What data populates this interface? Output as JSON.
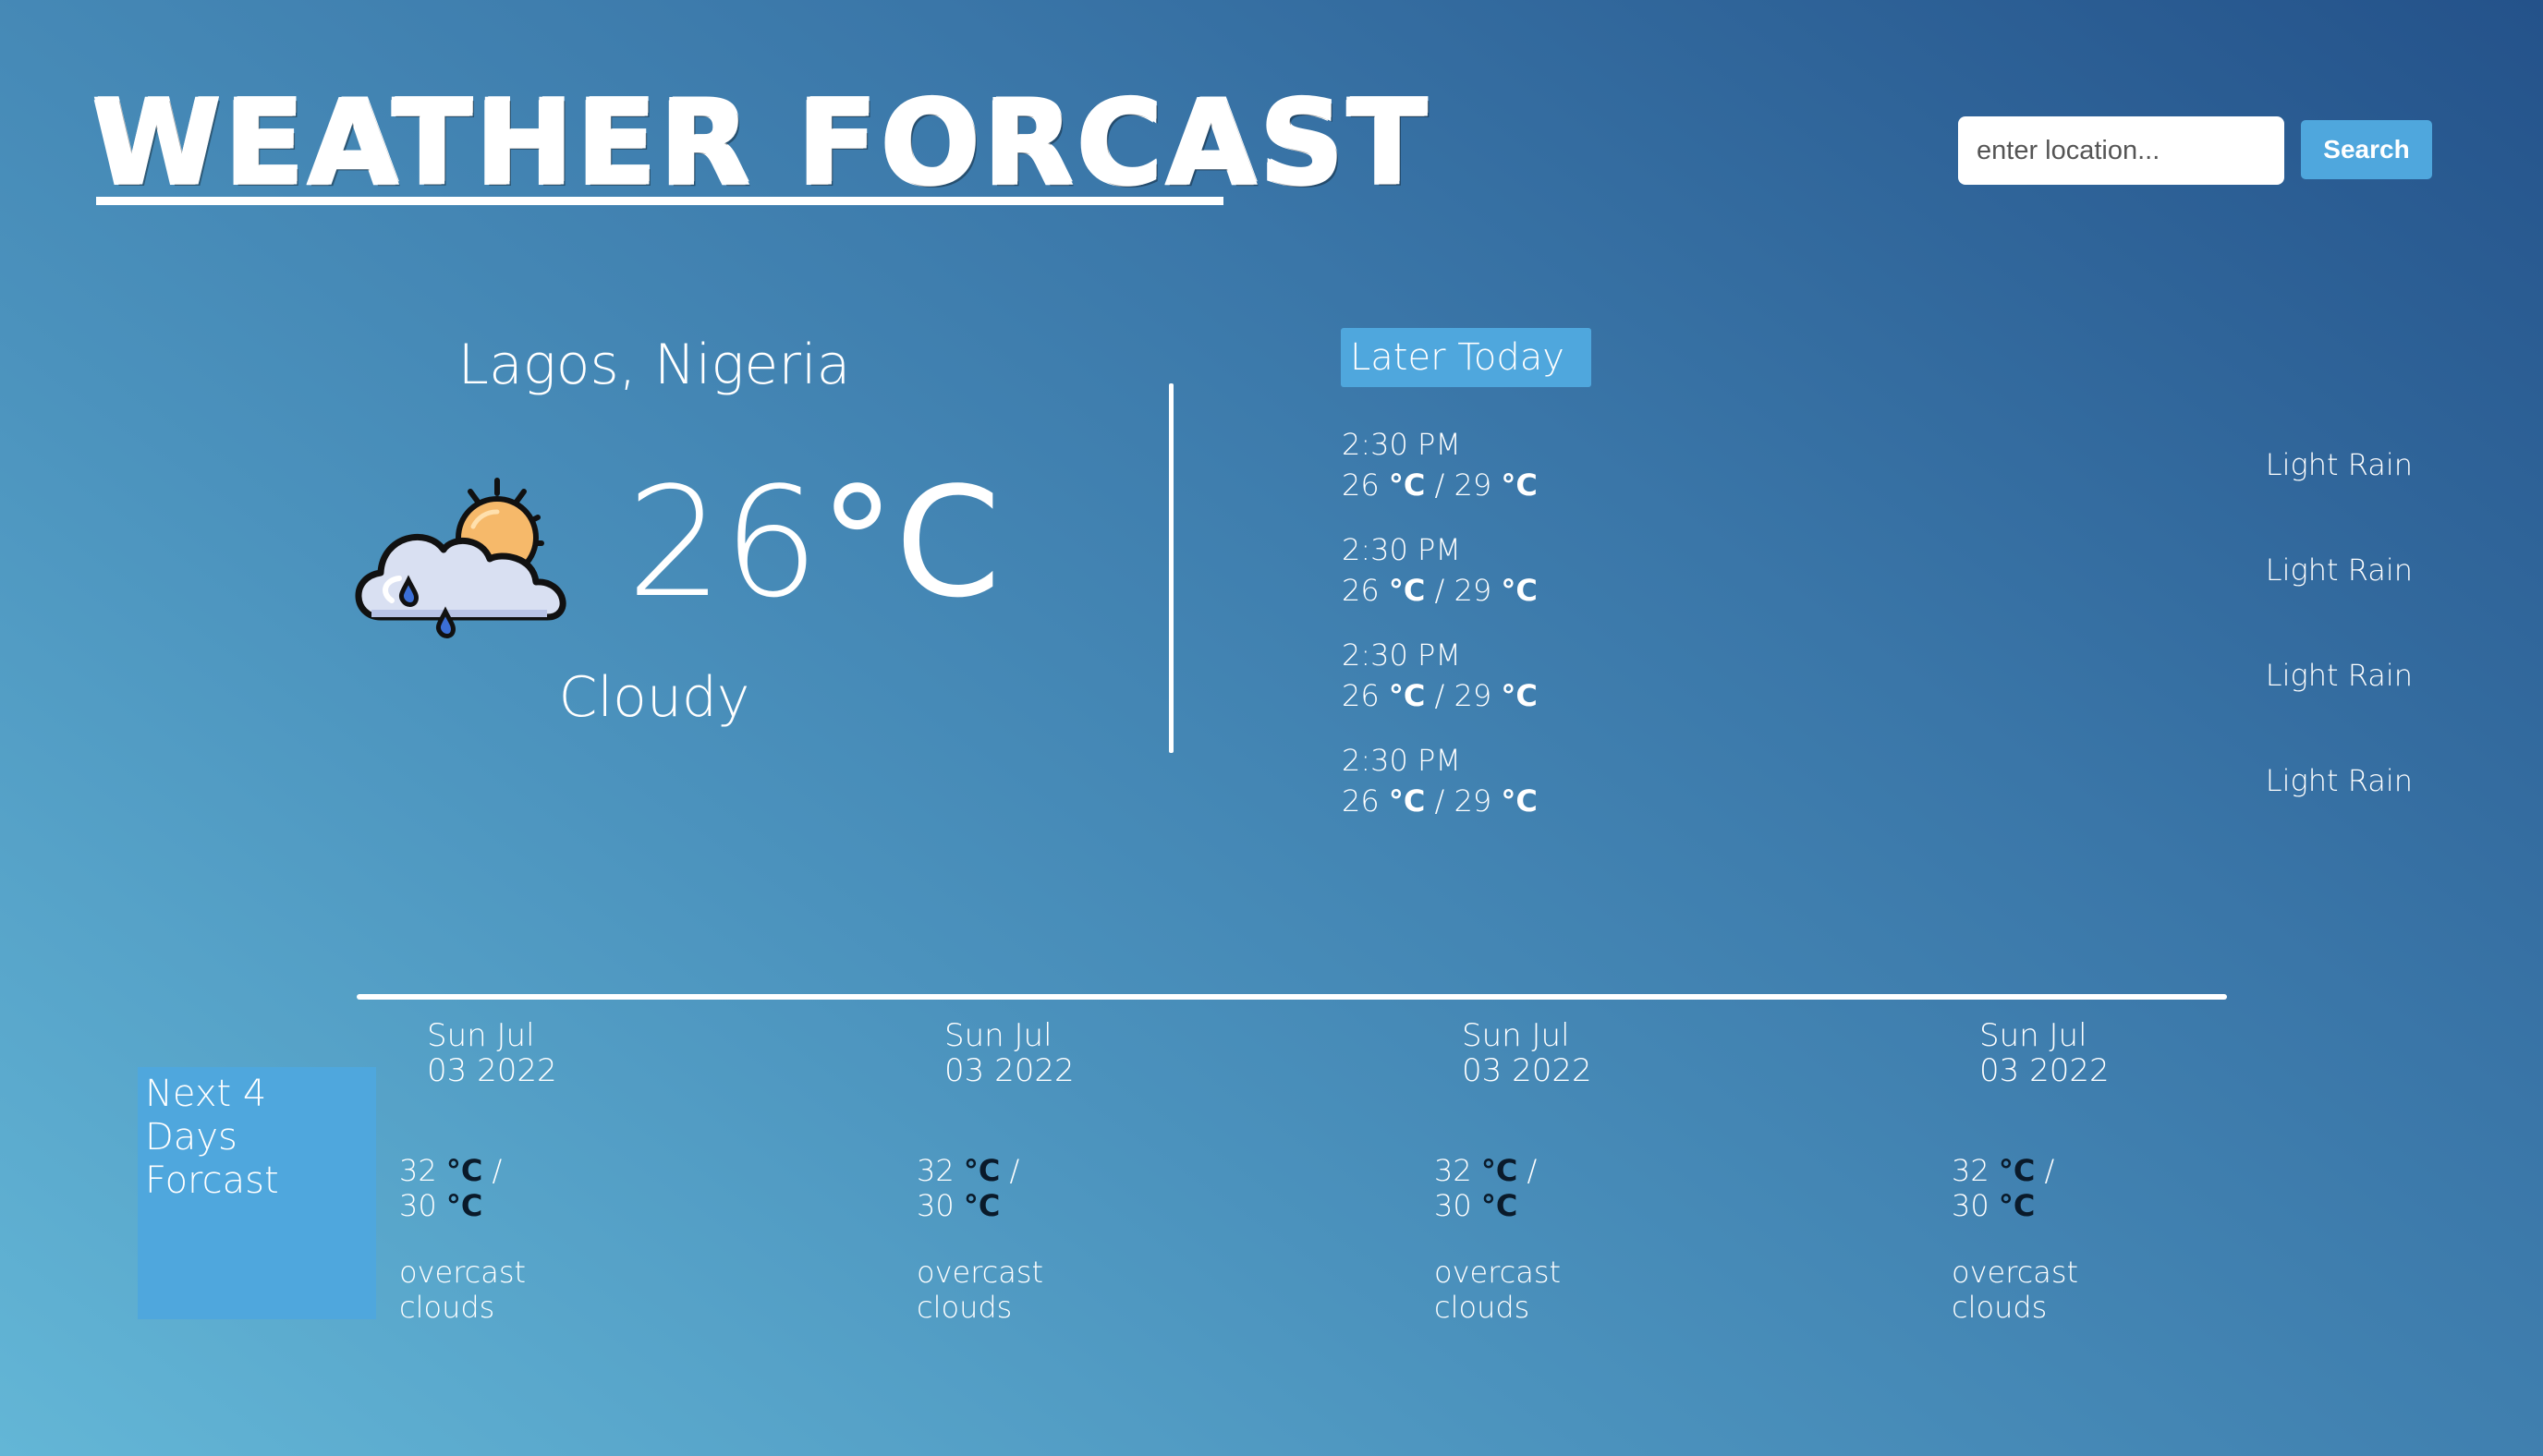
{
  "header": {
    "title": "WEATHER FORCAST",
    "search": {
      "placeholder": "enter location...",
      "value": "",
      "button_label": "Search"
    }
  },
  "current": {
    "location": "Lagos, Nigeria",
    "temperature": "26",
    "unit": "°C",
    "condition": "Cloudy",
    "icon": "cloud-sun-rain-icon"
  },
  "later_today": {
    "label": "Later Today",
    "items": [
      {
        "time": "2:30 PM",
        "low": "26",
        "high": "29",
        "unit": "°C",
        "condition": "Light Rain"
      },
      {
        "time": "2:30 PM",
        "low": "26",
        "high": "29",
        "unit": "°C",
        "condition": "Light Rain"
      },
      {
        "time": "2:30 PM",
        "low": "26",
        "high": "29",
        "unit": "°C",
        "condition": "Light Rain"
      },
      {
        "time": "2:30 PM",
        "low": "26",
        "high": "29",
        "unit": "°C",
        "condition": "Light Rain"
      }
    ]
  },
  "forecast": {
    "label": "Next 4 Days Forcast",
    "days": [
      {
        "date": "Sun Jul 03 2022",
        "high": "32",
        "low": "30",
        "unit": "°C",
        "description": "overcast clouds"
      },
      {
        "date": "Sun Jul 03 2022",
        "high": "32",
        "low": "30",
        "unit": "°C",
        "description": "overcast clouds"
      },
      {
        "date": "Sun Jul 03 2022",
        "high": "32",
        "low": "30",
        "unit": "°C",
        "description": "overcast clouds"
      },
      {
        "date": "Sun Jul 03 2022",
        "high": "32",
        "low": "30",
        "unit": "°C",
        "description": "overcast clouds"
      }
    ]
  },
  "colors": {
    "accent": "#4fa7dd",
    "text": "#ffffff",
    "unit_dark": "#0a1a2a"
  }
}
